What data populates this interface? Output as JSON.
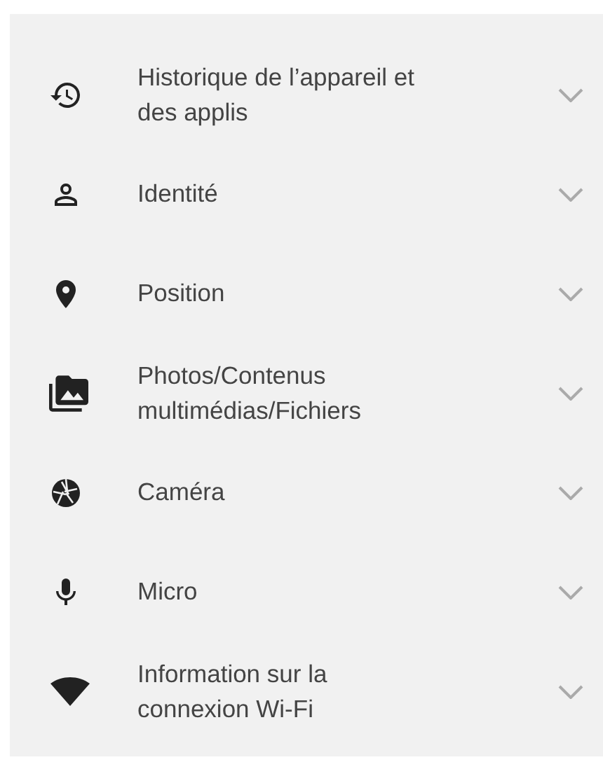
{
  "permissions": [
    {
      "label": "Historique de l’appareil et des applis",
      "expanded": false
    },
    {
      "label": "Identité",
      "expanded": false
    },
    {
      "label": "Position",
      "expanded": false
    },
    {
      "label": "Photos/Contenus multimédias/Fichiers",
      "expanded": false
    },
    {
      "label": "Caméra",
      "expanded": false
    },
    {
      "label": "Micro",
      "expanded": false
    },
    {
      "label": "Information sur la connexion Wi-Fi",
      "expanded": false
    }
  ]
}
